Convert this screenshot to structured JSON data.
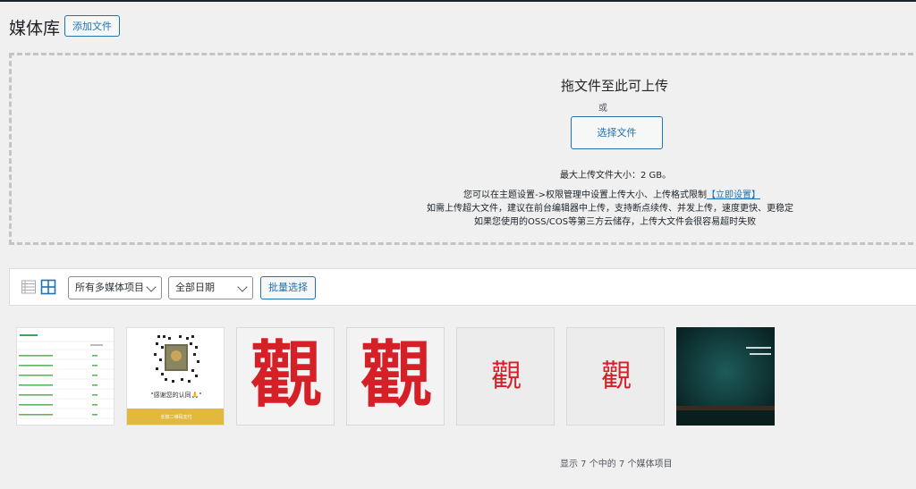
{
  "header": {
    "title": "媒体库",
    "add_button": "添加文件"
  },
  "uploader": {
    "drop_title": "拖文件至此可上传",
    "or_text": "或",
    "select_button": "选择文件",
    "max_size": "最大上传文件大小：2 GB。",
    "note_1": "您可以在主题设置->权限管理中设置上传大小、上传格式限制",
    "note_1_link": "【立即设置】",
    "note_2": "如需上传超大文件，建议在前台编辑器中上传，支持断点续传、并发上传，速度更快、更稳定",
    "note_3": "如果您使用的OSS/COS等第三方云储存，上传大文件会很容易超时失败"
  },
  "toolbar": {
    "list_view_icon": "list-view-icon",
    "grid_view_icon": "grid-view-icon",
    "type_filter": "所有多媒体项目",
    "date_filter": "全部日期",
    "bulk_select": "批量选择"
  },
  "media_items": [
    {
      "kind": "table-screenshot"
    },
    {
      "kind": "qr-card",
      "caption": "\"感谢您的认同🙏\"",
      "footer": "长按二维码支付"
    },
    {
      "kind": "calligraphy",
      "glyph": "觀"
    },
    {
      "kind": "calligraphy",
      "glyph": "觀"
    },
    {
      "kind": "calligraphy-small",
      "glyph": "觀"
    },
    {
      "kind": "calligraphy-small",
      "glyph": "觀"
    },
    {
      "kind": "dark-slide"
    }
  ],
  "footer": {
    "count_text": "显示 7 个中的 7 个媒体项目"
  },
  "colors": {
    "accent": "#2271b1",
    "calligraphy_red": "#d62027",
    "qr_footer": "#e3b83f",
    "slide_dark": "#0d2f2f"
  }
}
